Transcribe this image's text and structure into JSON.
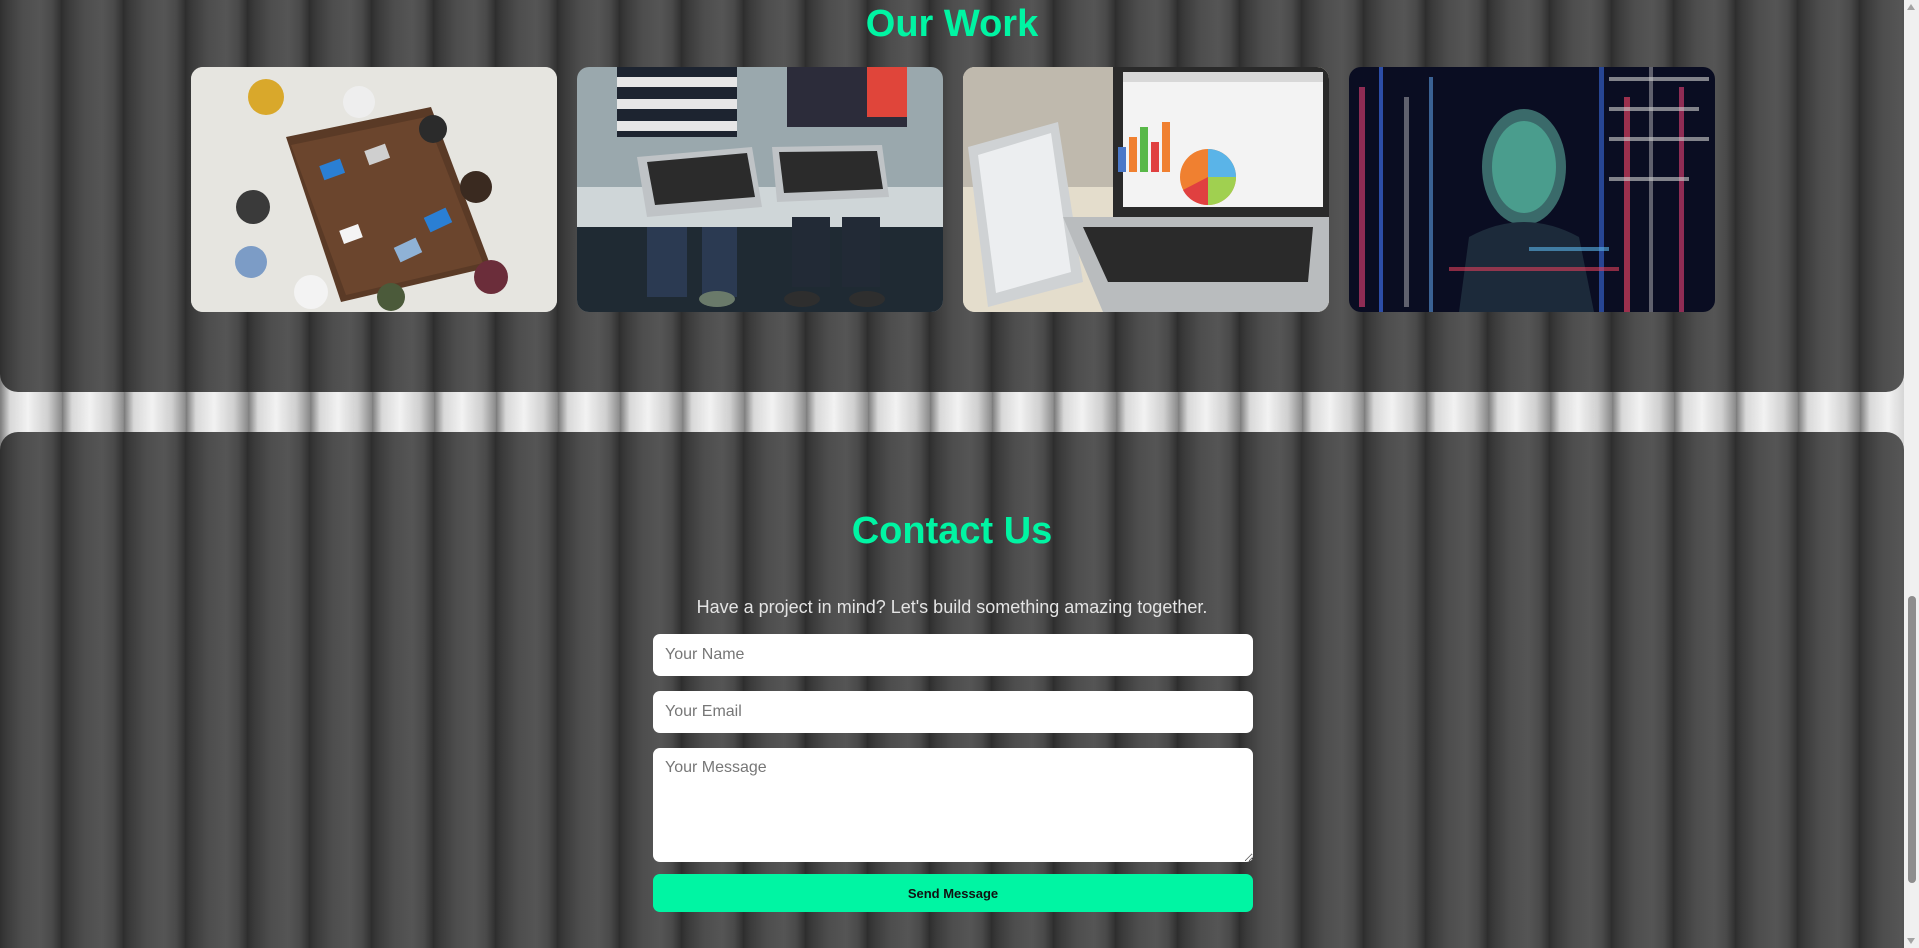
{
  "work": {
    "title": "Our Work",
    "images": [
      {
        "name": "team-meeting-photo",
        "alt": "Team meeting around a table"
      },
      {
        "name": "laptops-photo",
        "alt": "Two people typing on laptops"
      },
      {
        "name": "analytics-laptop-photo",
        "alt": "Laptop and tablet with charts"
      },
      {
        "name": "code-projection-photo",
        "alt": "Woman with projected code"
      }
    ]
  },
  "contact": {
    "title": "Contact Us",
    "subtitle": "Have a project in mind? Let's build something amazing together.",
    "name_placeholder": "Your Name",
    "email_placeholder": "Your Email",
    "message_placeholder": "Your Message",
    "submit_label": "Send Message"
  },
  "colors": {
    "accent": "#00f5a3",
    "panel": "#454545",
    "field_bg": "#ffffff"
  }
}
